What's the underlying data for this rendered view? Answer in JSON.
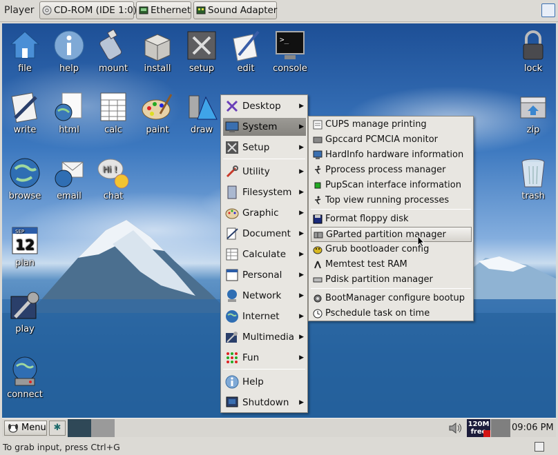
{
  "vm": {
    "player_label": "Player",
    "devices": [
      "CD-ROM (IDE 1:0)",
      "Ethernet",
      "Sound Adapter"
    ]
  },
  "desktop_icons": {
    "file": "file",
    "help": "help",
    "mount": "mount",
    "install": "install",
    "setup": "setup",
    "edit": "edit",
    "console": "console",
    "lock": "lock",
    "write": "write",
    "html": "html",
    "calc": "calc",
    "paint": "paint",
    "draw": "draw",
    "zip": "zip",
    "browse": "browse",
    "email": "email",
    "chat": "chat",
    "trash": "trash",
    "plan": "plan",
    "play": "play",
    "connect": "connect"
  },
  "main_menu": [
    "Desktop",
    "System",
    "Setup",
    "Utility",
    "Filesystem",
    "Graphic",
    "Document",
    "Calculate",
    "Personal",
    "Network",
    "Internet",
    "Multimedia",
    "Fun",
    "Help",
    "Shutdown"
  ],
  "system_submenu": [
    "CUPS manage printing",
    "Gpccard PCMCIA monitor",
    "HardInfo hardware information",
    "Pprocess process manager",
    "PupScan interface information",
    "Top view running processes",
    "Format floppy disk",
    "GParted partition manager",
    "Grub bootloader config",
    "Memtest test RAM",
    "Pdisk partition manager",
    "BootManager configure bootup",
    "Pschedule task on time"
  ],
  "taskbar": {
    "menu_label": "Menu",
    "free_line1": "120M",
    "free_line2": "free",
    "clock": "09:06 PM"
  },
  "plan_date": {
    "month": "SEP",
    "day": "12"
  },
  "status": {
    "hint": "To grab input, press Ctrl+G"
  },
  "colors": {
    "menu_bg": "#e8e6e1",
    "menu_active": "#8e8c87",
    "desktop_sky": "#3c78bf",
    "taskbar": "#d8d6d1"
  }
}
